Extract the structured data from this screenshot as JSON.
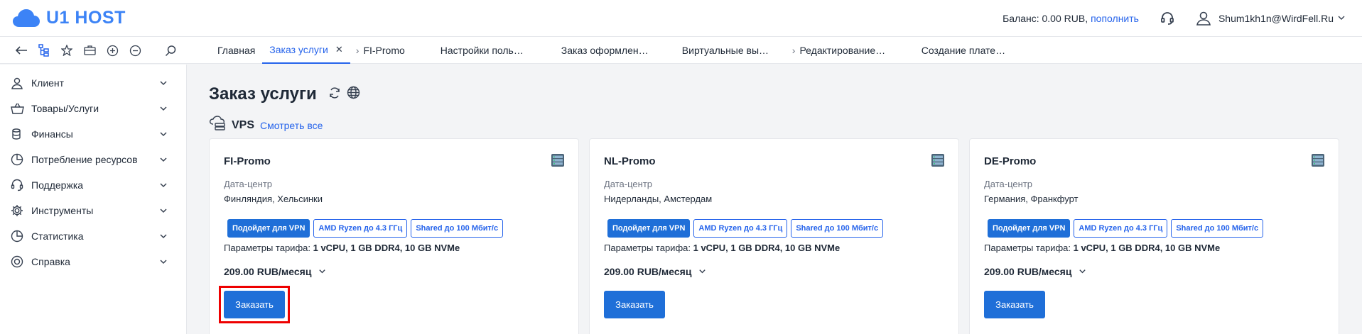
{
  "header": {
    "brand": "U1 HOST",
    "balance_label": "Баланс: 0.00 RUB,",
    "topup_link": "пополнить",
    "user_email": "Shum1kh1n@WirdFell.Ru",
    "brand_color": "#3c83f6"
  },
  "toolbar": {
    "tools": [
      "back-arrow-icon",
      "tree-icon",
      "star-icon",
      "briefcase-icon",
      "plus-circle-icon",
      "minus-circle-icon",
      "search-icon"
    ]
  },
  "tabs": [
    {
      "label": "Главная",
      "active": false
    },
    {
      "label": "Заказ услуги",
      "active": true
    },
    {
      "label": "FI-Promo",
      "active": false
    },
    {
      "label": "Настройки поль…",
      "active": false
    },
    {
      "label": "Заказ оформлен…",
      "active": false
    },
    {
      "label": "Виртуальные вы…",
      "active": false
    },
    {
      "label": "Редактирование…",
      "active": false
    },
    {
      "label": "Создание плате…",
      "active": false
    }
  ],
  "sidebar": {
    "items": [
      {
        "label": "Клиент",
        "icon": "user-icon"
      },
      {
        "label": "Товары/Услуги",
        "icon": "basket-icon"
      },
      {
        "label": "Финансы",
        "icon": "coins-icon"
      },
      {
        "label": "Потребление ресурсов",
        "icon": "pie-chart-icon"
      },
      {
        "label": "Поддержка",
        "icon": "headset-icon"
      },
      {
        "label": "Инструменты",
        "icon": "gear-icon"
      },
      {
        "label": "Статистика",
        "icon": "pie-chart-icon"
      },
      {
        "label": "Справка",
        "icon": "lifebuoy-icon"
      }
    ]
  },
  "main": {
    "title": "Заказ услуги",
    "section_label": "VPS",
    "section_link": "Смотреть все",
    "cards": [
      {
        "title": "FI-Promo",
        "dc_label": "Дата-центр",
        "dc_value": "Финляндия, Хельсинки",
        "badges": [
          "Подойдет для VPN",
          "AMD Ryzen до 4.3 ГГц",
          "Shared до 100 Мбит/с"
        ],
        "params_label": "Параметры тарифа:",
        "params_value": "1 vCPU, 1 GB DDR4, 10 GB NVMe",
        "price": "209.00 RUB/месяц",
        "order_label": "Заказать"
      },
      {
        "title": "NL-Promo",
        "dc_label": "Дата-центр",
        "dc_value": "Нидерланды, Амстердам",
        "badges": [
          "Подойдет для VPN",
          "AMD Ryzen до 4.3 ГГц",
          "Shared до 100 Мбит/с"
        ],
        "params_label": "Параметры тарифа:",
        "params_value": "1 vCPU, 1 GB DDR4, 10 GB NVMe",
        "price": "209.00 RUB/месяц",
        "order_label": "Заказать"
      },
      {
        "title": "DE-Promo",
        "dc_label": "Дата-центр",
        "dc_value": "Германия, Франкфурт",
        "badges": [
          "Подойдет для VPN",
          "AMD Ryzen до 4.3 ГГц",
          "Shared до 100 Мбит/с"
        ],
        "params_label": "Параметры тарифа:",
        "params_value": "1 vCPU, 1 GB DDR4, 10 GB NVMe",
        "price": "209.00 RUB/месяц",
        "order_label": "Заказать"
      }
    ]
  }
}
